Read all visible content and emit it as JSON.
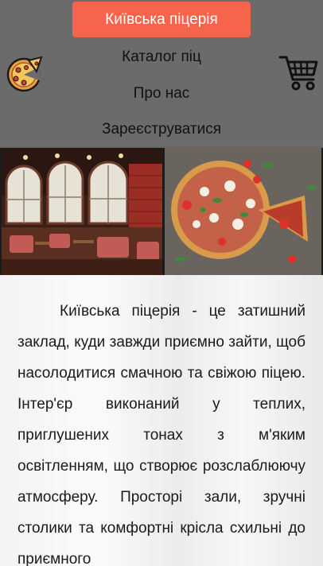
{
  "header": {
    "logo_icon": "pizza-logo-icon",
    "cart_icon": "cart-icon",
    "background_color": "#6b6b6b",
    "accent_color": "#f7644c"
  },
  "nav": {
    "items": [
      {
        "label": "Київська піцерія",
        "active": true
      },
      {
        "label": "Каталог піц",
        "active": false
      },
      {
        "label": "Про нас",
        "active": false
      },
      {
        "label": "Зареєструватися",
        "active": false
      }
    ]
  },
  "hero": {
    "images": [
      "restaurant-interior-photo",
      "pizza-photo"
    ]
  },
  "main": {
    "description": "Київська піцерія - це затишний заклад, куди завжди приємно зайти, щоб насолодитися смачною та свіжою піцею. Інтер'єр виконаний у теплих, приглушених тонах з м'яким освітленням, що створює розслаблюючу атмосферу. Просторі зали, зручні столики та комфортні крісла схильні до приємного"
  }
}
